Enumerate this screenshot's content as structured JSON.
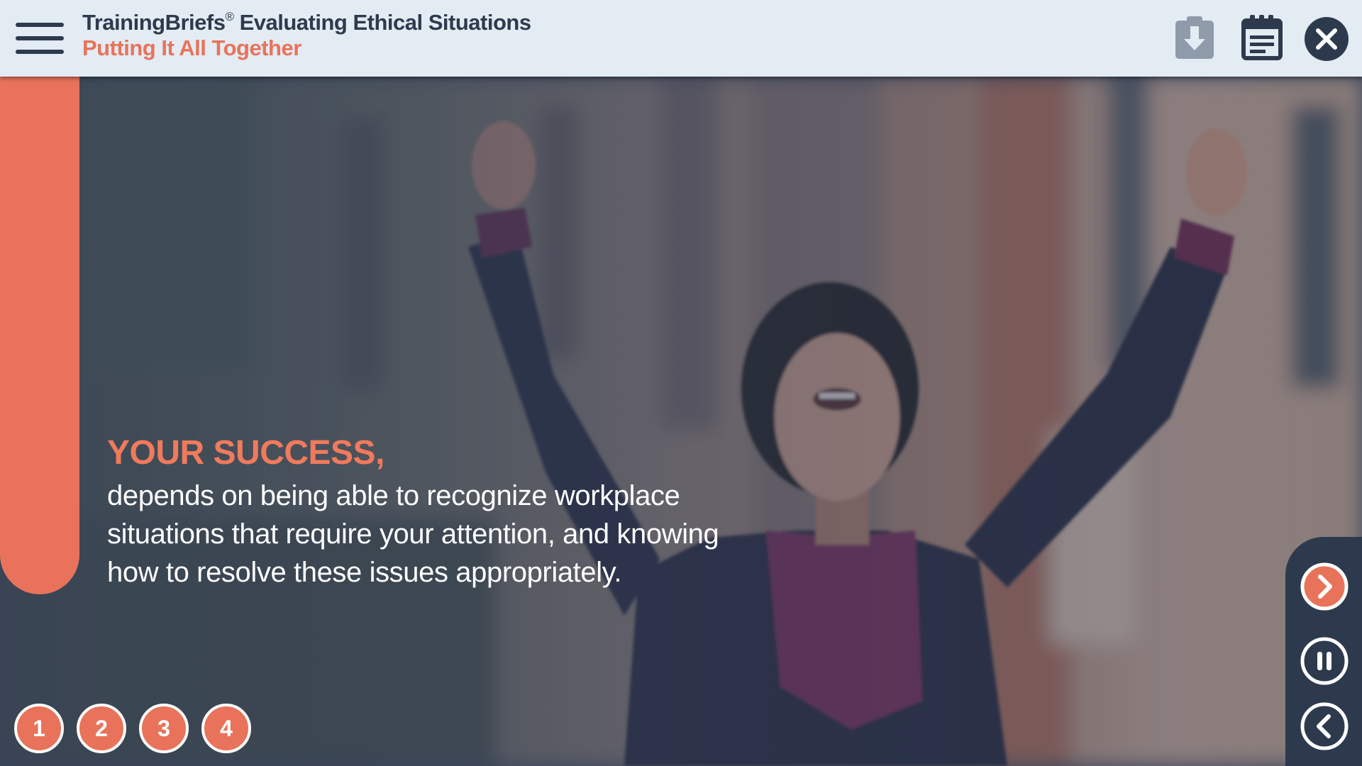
{
  "header": {
    "course_brand": "TrainingBriefs",
    "registered_mark": "®",
    "course_title": "Evaluating Ethical Situations",
    "section_title": "Putting It All Together",
    "icons": {
      "menu": "hamburger-menu-icon",
      "download": "download-icon",
      "notes": "notepad-icon",
      "close": "close-icon"
    }
  },
  "slide": {
    "heading": "YOUR SUCCESS,",
    "body": "depends on being able to recognize workplace situations that require your attention, and knowing how to resolve these issues appropriately."
  },
  "pages": [
    "1",
    "2",
    "3",
    "4"
  ],
  "controls": {
    "next": "chevron-right-icon",
    "pause": "pause-icon",
    "back": "chevron-left-icon"
  },
  "colors": {
    "accent": "#e8735a",
    "navy": "#2d3a4e",
    "header_bg": "#e3ebf3"
  }
}
